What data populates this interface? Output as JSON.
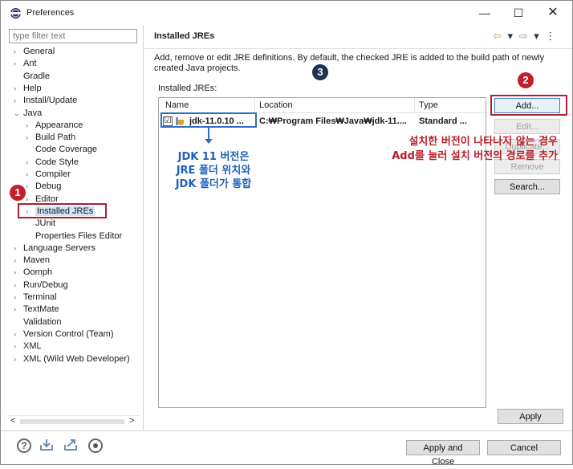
{
  "window": {
    "title": "Preferences",
    "min_glyph": "—",
    "max_glyph": "☐",
    "close_glyph": "✕"
  },
  "left": {
    "filter_placeholder": "type filter text",
    "tree": [
      {
        "label": "General",
        "arrow": "›",
        "level": 0
      },
      {
        "label": "Ant",
        "arrow": "›",
        "level": 0
      },
      {
        "label": "Gradle",
        "arrow": "",
        "level": 0
      },
      {
        "label": "Help",
        "arrow": "›",
        "level": 0
      },
      {
        "label": "Install/Update",
        "arrow": "›",
        "level": 0
      },
      {
        "label": "Java",
        "arrow": "⌄",
        "level": 0
      },
      {
        "label": "Appearance",
        "arrow": "›",
        "level": 1
      },
      {
        "label": "Build Path",
        "arrow": "›",
        "level": 1
      },
      {
        "label": "Code Coverage",
        "arrow": "",
        "level": 1
      },
      {
        "label": "Code Style",
        "arrow": "›",
        "level": 1
      },
      {
        "label": "Compiler",
        "arrow": "›",
        "level": 1
      },
      {
        "label": "Debug",
        "arrow": "›",
        "level": 1
      },
      {
        "label": "Editor",
        "arrow": "›",
        "level": 1
      },
      {
        "label": "Installed JREs",
        "arrow": "›",
        "level": 1,
        "selected": true
      },
      {
        "label": "JUnit",
        "arrow": "",
        "level": 1
      },
      {
        "label": "Properties Files Editor",
        "arrow": "",
        "level": 1
      },
      {
        "label": "Language Servers",
        "arrow": "›",
        "level": 0
      },
      {
        "label": "Maven",
        "arrow": "›",
        "level": 0
      },
      {
        "label": "Oomph",
        "arrow": "›",
        "level": 0
      },
      {
        "label": "Run/Debug",
        "arrow": "›",
        "level": 0
      },
      {
        "label": "Terminal",
        "arrow": "›",
        "level": 0
      },
      {
        "label": "TextMate",
        "arrow": "›",
        "level": 0
      },
      {
        "label": "Validation",
        "arrow": "",
        "level": 0
      },
      {
        "label": "Version Control (Team)",
        "arrow": "›",
        "level": 0
      },
      {
        "label": "XML",
        "arrow": "›",
        "level": 0
      },
      {
        "label": "XML (Wild Web Developer)",
        "arrow": "›",
        "level": 0
      }
    ],
    "scroll_left": "<",
    "scroll_right": ">"
  },
  "right": {
    "title": "Installed JREs",
    "nav": {
      "back": "⇦",
      "back_menu": "▾",
      "forward": "⇨",
      "forward_menu": "▾",
      "more": "⋮"
    },
    "description": "Add, remove or edit JRE definitions. By default, the checked JRE is added to the build path of newly created Java projects.",
    "jres_label": "Installed JREs:",
    "table": {
      "headers": {
        "name": "Name",
        "location": "Location",
        "type": "Type"
      },
      "rows": [
        {
          "checked": "☑",
          "name": "jdk-11.0.10 ...",
          "location": "C:₩Program Files₩Java₩jdk-11....",
          "type": "Standard ..."
        }
      ]
    },
    "buttons": {
      "add": "Add...",
      "edit": "Edit...",
      "duplicate": "Duplicate...",
      "remove": "Remove",
      "search": "Search...",
      "apply": "Apply"
    }
  },
  "footer": {
    "apply_close": "Apply and Close",
    "cancel": "Cancel",
    "help_glyph": "?"
  },
  "annotations": {
    "badge1": "1",
    "badge2": "2",
    "badge3": "3",
    "note_blue": [
      "JDK 11 버전은",
      "JRE 폴더 위치와",
      "JDK 폴더가 통합"
    ],
    "note_red": [
      "설치한 버전이 나타나지 않는 경우",
      "Add를 눌러 설치 버전의 경로를 추가"
    ]
  },
  "colors": {
    "annotation_red": "#b21e2b",
    "annotation_blue": "#1f5fb8",
    "selection": "#cfe4f7",
    "button_face": "#e1e1e1"
  }
}
